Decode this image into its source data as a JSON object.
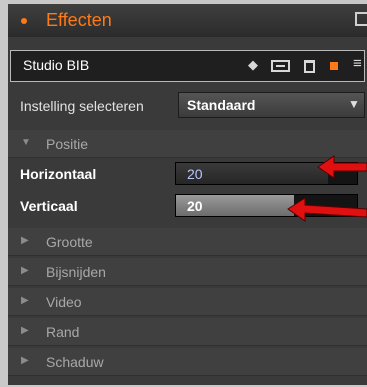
{
  "header": {
    "title": "Effecten"
  },
  "studio_bar": {
    "name": "Studio BIB",
    "icons": [
      "diamond-icon",
      "screen-icon",
      "trash-icon",
      "square-icon",
      "menu-icon"
    ]
  },
  "preset": {
    "label": "Instelling selecteren",
    "value": "Standaard"
  },
  "sections": [
    {
      "label": "Positie",
      "expanded": true
    },
    {
      "label": "Grootte",
      "expanded": false
    },
    {
      "label": "Bijsnijden",
      "expanded": false
    },
    {
      "label": "Video",
      "expanded": false
    },
    {
      "label": "Rand",
      "expanded": false
    },
    {
      "label": "Schaduw",
      "expanded": false
    }
  ],
  "params": [
    {
      "label": "Horizontaal",
      "value": "20"
    },
    {
      "label": "Verticaal",
      "value": "20"
    }
  ],
  "colors": {
    "accent": "#ff7a14",
    "annotation_arrow": "#e01010"
  }
}
